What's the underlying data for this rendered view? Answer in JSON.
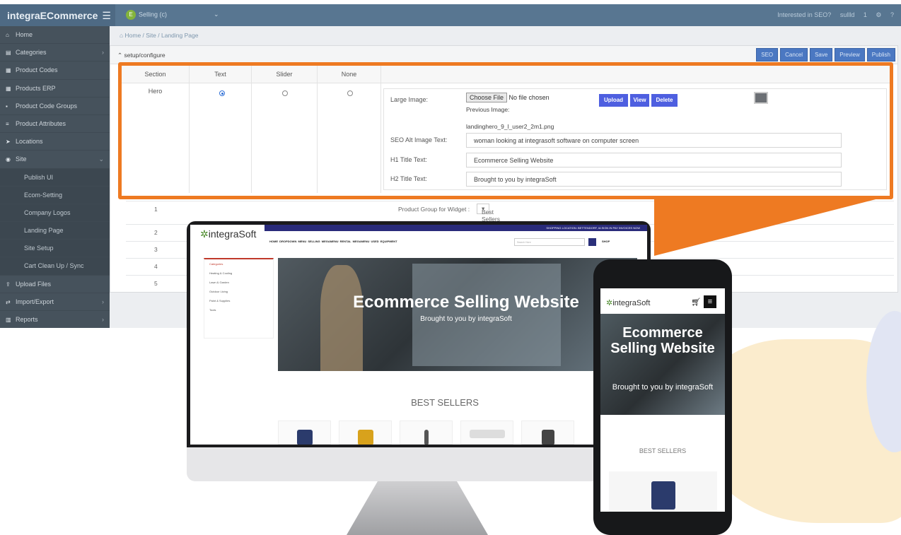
{
  "app": {
    "brand": "integraECommerce",
    "menu_icon": "hamburger-icon",
    "context_label": "Selling (c)",
    "topbar_right": [
      "Interested in SEO?",
      "sullld",
      "1"
    ],
    "colors": {
      "topbar": "#587691",
      "sidebar": "#46525c",
      "accent_orange": "#ee7a22",
      "button_blue": "#4b78c2"
    }
  },
  "sidebar": {
    "items": [
      {
        "label": "Home",
        "icon": "home-icon"
      },
      {
        "label": "Categories",
        "icon": "categories-icon"
      },
      {
        "label": "Product Codes",
        "icon": "grid-icon"
      },
      {
        "label": "Products ERP",
        "icon": "grid-icon"
      },
      {
        "label": "Product Code Groups",
        "icon": "groups-icon"
      },
      {
        "label": "Product Attributes",
        "icon": "list-icon"
      },
      {
        "label": "Locations",
        "icon": "location-icon"
      },
      {
        "label": "Site",
        "icon": "globe-icon"
      }
    ],
    "sub_items": [
      "Publish UI",
      "Ecom-Setting",
      "Company Logos",
      "Landing Page",
      "Site Setup",
      "Cart Clean Up / Sync"
    ],
    "bottom_items": [
      {
        "label": "Upload Files",
        "icon": "upload-icon"
      },
      {
        "label": "Import/Export",
        "icon": "exchange-icon"
      },
      {
        "label": "Reports",
        "icon": "reports-icon"
      }
    ]
  },
  "breadcrumb": "Home / Site / Landing Page",
  "panel": {
    "title": "setup/configure",
    "actions": [
      "SEO",
      "Cancel",
      "Save",
      "Preview",
      "Publish"
    ]
  },
  "config": {
    "columns": [
      "Section",
      "Text",
      "Slider",
      "None"
    ],
    "row_section": "Hero",
    "selected": "Text",
    "large_image_label": "Large Image:",
    "choose_file": "Choose File",
    "no_file": "No file chosen",
    "previous_image_label": "Previous Image:",
    "previous_image_name": "landinghero_9_l_user2_2m1.png",
    "buttons": [
      "Upload",
      "View",
      "Delete"
    ],
    "seo_alt_label": "SEO Alt Image Text:",
    "seo_alt_value": "woman looking at integrasoft software on computer screen",
    "h1_label": "H1 Title Text:",
    "h1_value": "Ecommerce Selling Website",
    "h2_label": "H2 Title Text:",
    "h2_value": "Brought to you by integraSoft"
  },
  "bg_rows": {
    "numbers": [
      "1",
      "2",
      "3",
      "4",
      "5"
    ],
    "widget_label": "Product Group for Widget :",
    "widget_value": "Best Sellers"
  },
  "desktop_site": {
    "logo_prefix": "✲",
    "logo": "integraSoft",
    "topbar": "SHOPPING LOCATION: BETTENDORF, IA   SIGN IN   PAY INVOICES NOW",
    "nav": "HOME   DROPDOWN MENU   SELLING MEGAMENU   RENTAL MEGAMENU   USED EQUIPMENT",
    "search_placeholder": "Search Here",
    "shop": "SHOP",
    "categories_title": "Categories",
    "categories": [
      "Heating & Cooling",
      "Lawn & Garden",
      "Outdoor Living",
      "Paint & Supplies",
      "Tools"
    ],
    "hero_title": "Ecommerce Selling Website",
    "hero_sub": "Brought to you by integraSoft",
    "best_sellers": "BEST SELLERS"
  },
  "phone_site": {
    "logo": "integraSoft",
    "hero_title": "Ecommerce Selling Website",
    "hero_sub": "Brought to you by integraSoft",
    "best_sellers": "BEST SELLERS"
  }
}
